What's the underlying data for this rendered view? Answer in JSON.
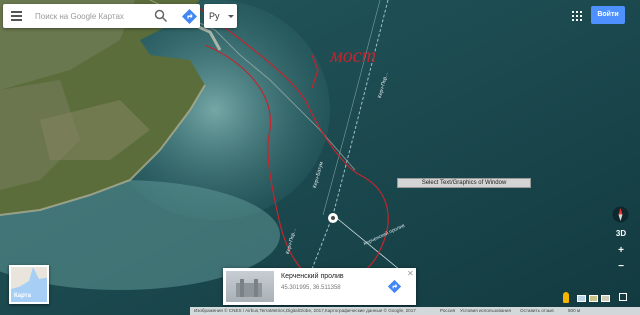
{
  "search": {
    "placeholder": "Поиск на Google Картах"
  },
  "language": {
    "selected": "Ру"
  },
  "login_label": "Войти",
  "annotation_text": "мост",
  "map_labels": {
    "road_top": "Керч-Пор…",
    "road_mid": "Керч-Батум",
    "road_lower": "Керч-Пор…",
    "strait": "Керченский пролив"
  },
  "context_menu": {
    "label": "Select Text/Graphics of Window"
  },
  "place_card": {
    "name": "Керченский пролив",
    "coords": "45.301995, 36.511358"
  },
  "minimap": {
    "label": "Карта"
  },
  "controls": {
    "tilt_label": "3D",
    "zoom_in": "+",
    "zoom_out": "−"
  },
  "footer": {
    "attribution": "Изображения © CNES / Airbus,TerraMetrics,DigitalGlobe, 2017,Картографические данные © Google, 2017",
    "country": "Россия",
    "terms": "Условия использования",
    "feedback": "Оставить отзыв",
    "scale": "500 м"
  },
  "colors": {
    "sea": "#1d4a4f",
    "land": "#5a6b3a",
    "annotation": "#c0262f",
    "accent": "#4d90fe"
  }
}
